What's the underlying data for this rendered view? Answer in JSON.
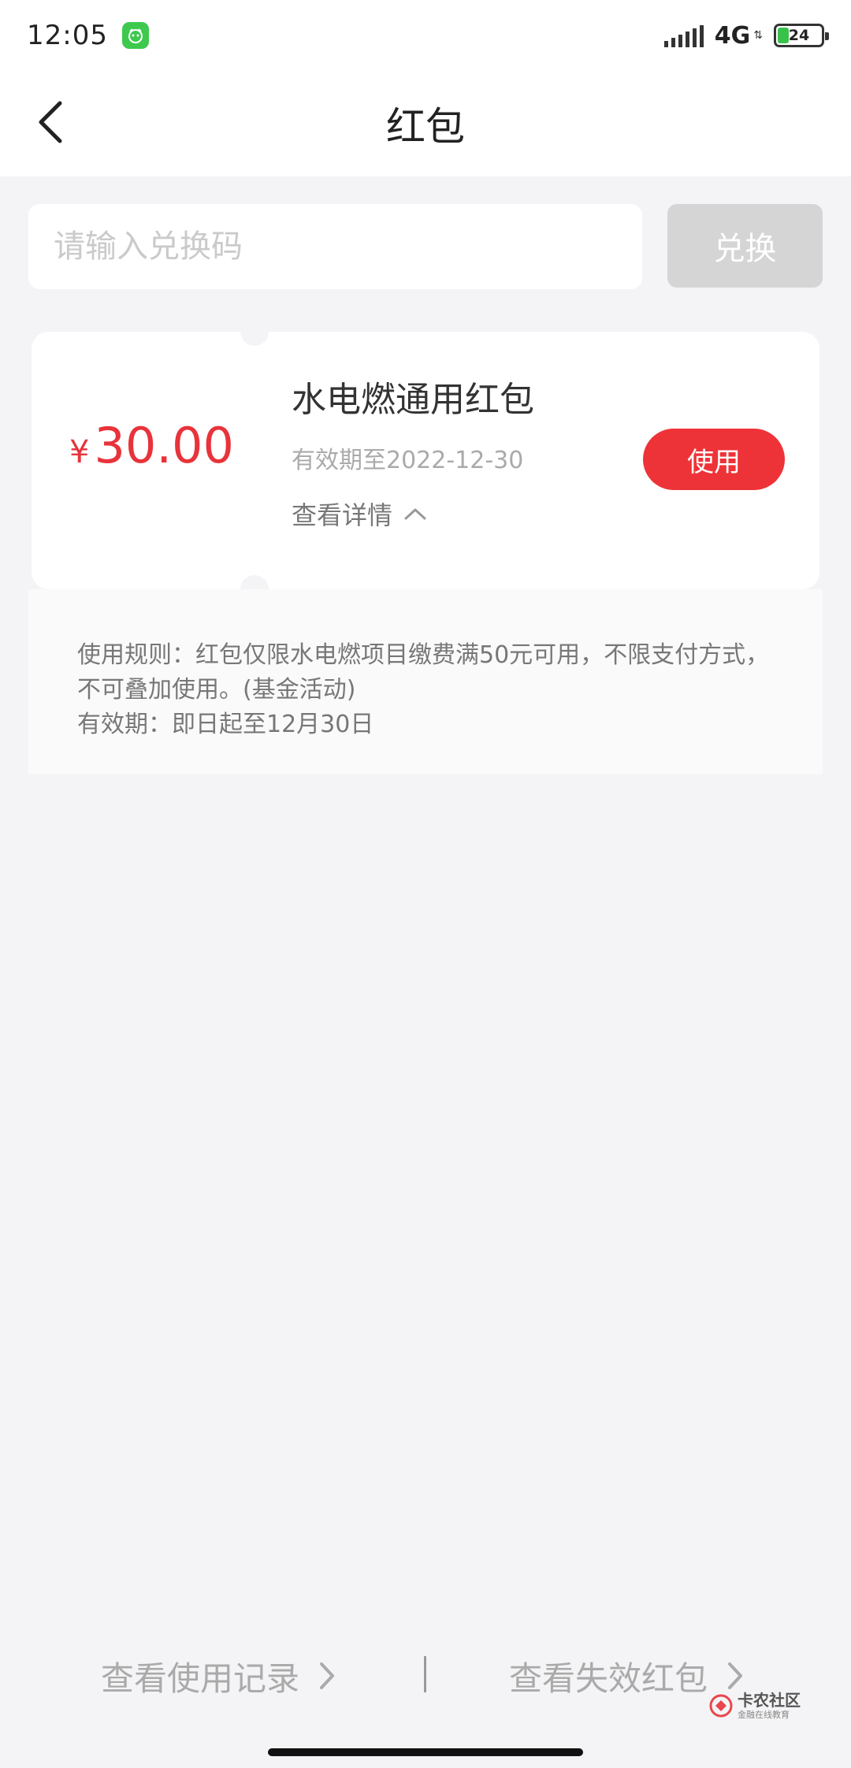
{
  "status_bar": {
    "time": "12:05",
    "network": "4G",
    "battery_level": "24",
    "icons": [
      "app-badge-icon",
      "signal-icon",
      "data-arrows-icon",
      "battery-icon"
    ]
  },
  "nav": {
    "title": "红包",
    "back_icon": "chevron-left-icon"
  },
  "redeem": {
    "placeholder": "请输入兑换码",
    "button_label": "兑换"
  },
  "coupon": {
    "currency": "¥",
    "amount": "30.00",
    "title": "水电燃通用红包",
    "expiry": "有效期至2022-12-30",
    "detail_label": "查看详情",
    "use_label": "使用"
  },
  "rules": {
    "line1": "使用规则：红包仅限水电燃项目缴费满50元可用，不限支付方式，不可叠加使用。(基金活动)",
    "line2": "有效期：即日起至12月30日"
  },
  "footer": {
    "history_label": "查看使用记录",
    "expired_label": "查看失效红包"
  },
  "watermark": {
    "title": "卡农社区",
    "subtitle": "金融在线教育"
  },
  "colors": {
    "accent": "#ee3338",
    "amount": "#e8333a",
    "disabled_button": "#d5d5d5",
    "background": "#f4f4f6"
  }
}
